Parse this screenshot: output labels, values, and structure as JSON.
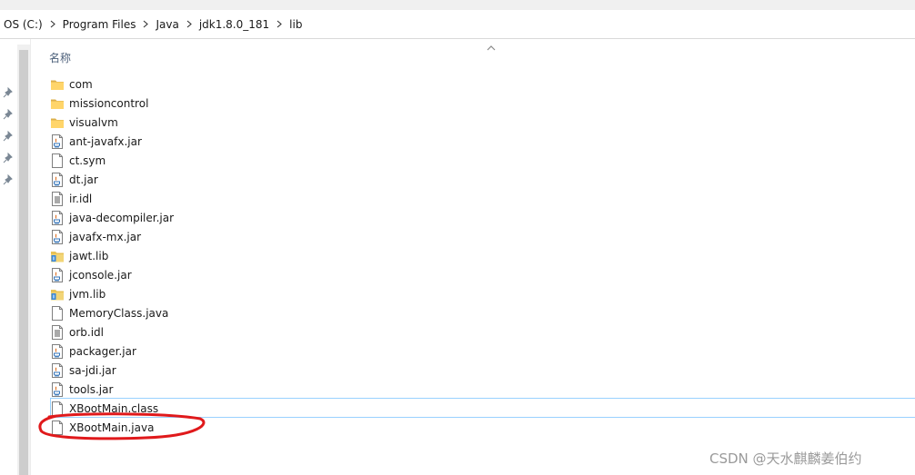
{
  "breadcrumb": [
    "OS (C:)",
    "Program Files",
    "Java",
    "jdk1.8.0_181",
    "lib"
  ],
  "column_header": "名称",
  "files": [
    {
      "name": "com",
      "icon": "folder-icon"
    },
    {
      "name": "missioncontrol",
      "icon": "folder-icon"
    },
    {
      "name": "visualvm",
      "icon": "folder-icon"
    },
    {
      "name": "ant-javafx.jar",
      "icon": "jar-file-icon"
    },
    {
      "name": "ct.sym",
      "icon": "blank-file-icon"
    },
    {
      "name": "dt.jar",
      "icon": "jar-file-icon"
    },
    {
      "name": "ir.idl",
      "icon": "text-file-icon"
    },
    {
      "name": "java-decompiler.jar",
      "icon": "jar-file-icon"
    },
    {
      "name": "javafx-mx.jar",
      "icon": "jar-file-icon"
    },
    {
      "name": "jawt.lib",
      "icon": "lib-file-icon"
    },
    {
      "name": "jconsole.jar",
      "icon": "jar-file-icon"
    },
    {
      "name": "jvm.lib",
      "icon": "lib-file-icon"
    },
    {
      "name": "MemoryClass.java",
      "icon": "blank-file-icon"
    },
    {
      "name": "orb.idl",
      "icon": "text-file-icon"
    },
    {
      "name": "packager.jar",
      "icon": "jar-file-icon"
    },
    {
      "name": "sa-jdi.jar",
      "icon": "jar-file-icon"
    },
    {
      "name": "tools.jar",
      "icon": "jar-file-icon"
    },
    {
      "name": "XBootMain.class",
      "icon": "blank-file-icon",
      "selected": true
    },
    {
      "name": "XBootMain.java",
      "icon": "blank-file-icon"
    }
  ],
  "annotation_color": "#e0191b",
  "selection_color": "#99d1ff",
  "watermark": "CSDN @天水麒麟姜伯约"
}
